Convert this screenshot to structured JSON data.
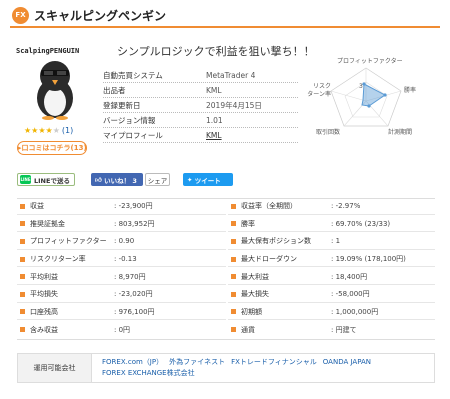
{
  "header": {
    "badge": "FX",
    "title": "スキャルピングペンギン"
  },
  "logo": {
    "text": "ScalpingPENGUIN"
  },
  "rating": {
    "stars_filled": 4,
    "stars_total": 5,
    "count": "(1)"
  },
  "review_button": "口コミはコチラ(13)",
  "tagline": "シンプルロジックで利益を狙い撃ち！！",
  "info": [
    {
      "label": "自動売買システム",
      "value": "MetaTrader 4"
    },
    {
      "label": "出品者",
      "value": "KML"
    },
    {
      "label": "登録更新日",
      "value": "2019年4月15日"
    },
    {
      "label": "バージョン情報",
      "value": "1.01"
    },
    {
      "label": "マイプロフィール",
      "value": "KML"
    }
  ],
  "radar": {
    "labels": {
      "profit_factor": "プロフィットファクター",
      "risk_return": "リスク\nターン率",
      "win_rate": "勝率",
      "trade_count": "取引回数",
      "planned_profit": "計測期間"
    },
    "tick_label": "3"
  },
  "share": {
    "line": "LINEで送る",
    "fb_like": "いいね！ 3",
    "fb_share": "シェア",
    "tweet": "ツイート"
  },
  "stats_left": [
    {
      "label": "収益",
      "value": ": -23,900円"
    },
    {
      "label": "推奨証拠金",
      "value": ": 803,952円"
    },
    {
      "label": "プロフィットファクター",
      "value": ": 0.90"
    },
    {
      "label": "リスクリターン率",
      "value": ": -0.13"
    },
    {
      "label": "平均利益",
      "value": ": 8,970円"
    },
    {
      "label": "平均損失",
      "value": ": -23,020円"
    },
    {
      "label": "口座残高",
      "value": ": 976,100円"
    },
    {
      "label": "含み収益",
      "value": ": 0円"
    }
  ],
  "stats_right": [
    {
      "label": "収益率（全期間）",
      "value": ": -2.97%"
    },
    {
      "label": "勝率",
      "value": ": 69.70% (23/33)"
    },
    {
      "label": "最大保有ポジション数",
      "value": ": 1"
    },
    {
      "label": "最大ドローダウン",
      "value": ": 19.09% (178,100円)"
    },
    {
      "label": "最大利益",
      "value": ": 18,400円"
    },
    {
      "label": "最大損失",
      "value": ": -58,000円"
    },
    {
      "label": "初期額",
      "value": ": 1,000,000円"
    },
    {
      "label": "通貨",
      "value": ": 円建て"
    }
  ],
  "broker": {
    "label": "運用可能会社",
    "companies": [
      "FOREX.com（JP）",
      "外為ファイネスト",
      "FXトレードフィナンシャル",
      "OANDA JAPAN",
      "FOREX EXCHANGE株式会社"
    ]
  },
  "colors": {
    "accent": "#f08c32",
    "link": "#1a5faa",
    "radar_fill": "#5b9bd5"
  }
}
